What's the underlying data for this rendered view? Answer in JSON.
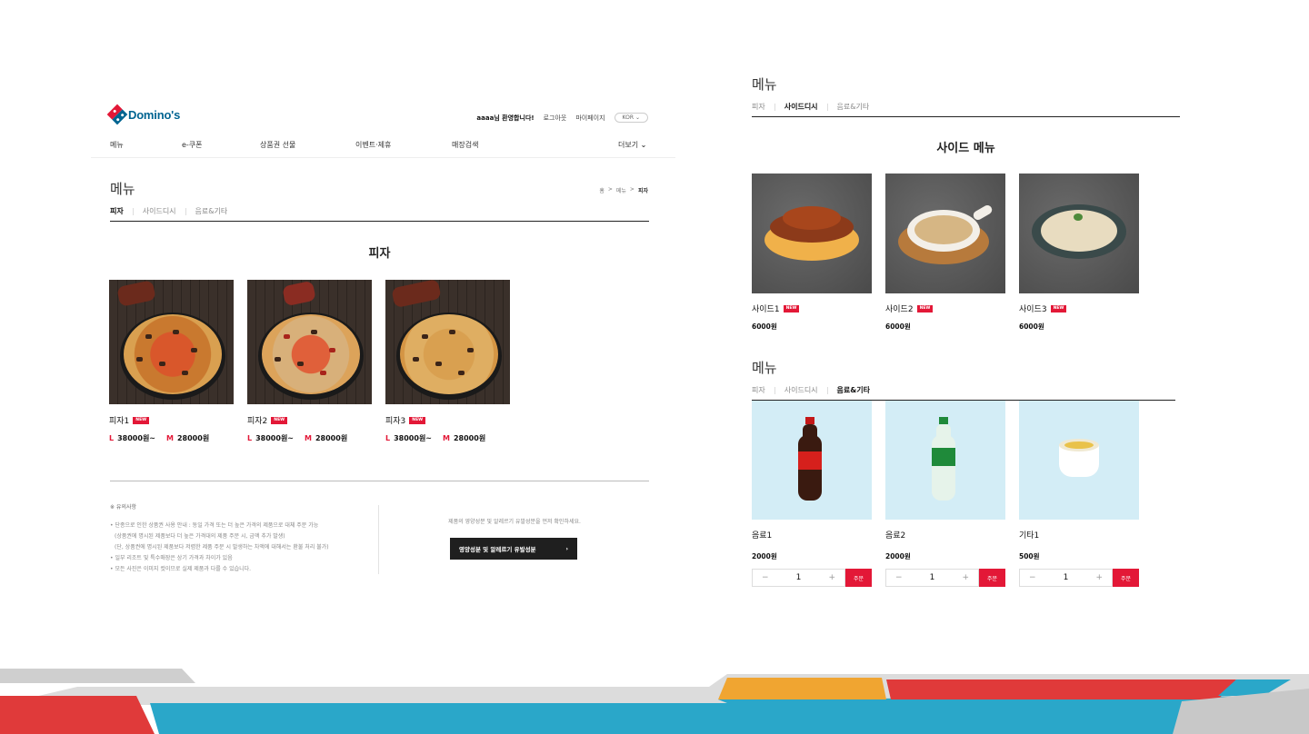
{
  "left": {
    "brand": "Domino's",
    "util": {
      "welcome": "aaaa님 환영합니다!",
      "logout": "로그아웃",
      "mypage": "마이페이지",
      "lang": "KOR"
    },
    "gnb": [
      "메뉴",
      "e-쿠폰",
      "상품권 선물",
      "이벤트·제휴",
      "매장검색",
      "더보기"
    ],
    "title": "메뉴",
    "breadcrumb": [
      "홈",
      ">",
      "메뉴",
      ">",
      "피자"
    ],
    "tabs": [
      "피자",
      "사이드디시",
      "음료&기타"
    ],
    "section": "피자",
    "new_label": "NEW",
    "pizzas": [
      {
        "name": "피자1",
        "l_label": "L",
        "l_price": "38000원~",
        "m_label": "M",
        "m_price": "28000원"
      },
      {
        "name": "피자2",
        "l_label": "L",
        "l_price": "38000원~",
        "m_label": "M",
        "m_price": "28000원"
      },
      {
        "name": "피자3",
        "l_label": "L",
        "l_price": "38000원~",
        "m_label": "M",
        "m_price": "28000원"
      }
    ],
    "notice": {
      "title": "※ 유의사항",
      "items": [
        "• 단종으로 인한 상품권 사용 안내 : 동일 가격 또는 더 높은 가격의 제품으로 대체 주문 가능",
        "  (상품권에 명시된 제품보다 더 높은 가격대의 제품 주문 시, 금액 추가 발생)",
        "  (단, 상품권에 명시된 제품보다 저렴한 제품 주문 시 발생하는 차액에 대해서는 환불 처리 불가)",
        "• 일부 리조트 및 특수매장은 상기 가격과 차이가 있음",
        "• 모든 사진은 이미지 컷이므로 실제 제품과 다를 수 있습니다."
      ]
    },
    "nutrition": {
      "text": "제품의 영양성분 및 알레르기 유발성분을 먼저 확인하세요.",
      "button": "영양성분 및 알레르기 유발성분"
    }
  },
  "right": {
    "side_title": "메뉴",
    "side_tabs": [
      "피자",
      "사이드디시",
      "음료&기타"
    ],
    "side_section": "사이드 메뉴",
    "new_label": "NEW",
    "sides": [
      {
        "name": "사이드1",
        "price": "6000원"
      },
      {
        "name": "사이드2",
        "price": "6000원"
      },
      {
        "name": "사이드3",
        "price": "6000원"
      }
    ],
    "drink_title": "메뉴",
    "drink_tabs": [
      "피자",
      "사이드디시",
      "음료&기타"
    ],
    "drinks": [
      {
        "name": "음료1",
        "price": "2000원",
        "qty": "1",
        "minus": "−",
        "plus": "+",
        "order": "주문"
      },
      {
        "name": "음료2",
        "price": "2000원",
        "qty": "1",
        "minus": "−",
        "plus": "+",
        "order": "주문"
      },
      {
        "name": "기타1",
        "price": "500원",
        "qty": "1",
        "minus": "−",
        "plus": "+",
        "order": "주문"
      }
    ]
  },
  "colors": {
    "brand_red": "#e31837",
    "brand_blue": "#006491",
    "decor_red": "#e03a3a",
    "decor_teal": "#2aa7c9",
    "decor_orange": "#f0a531",
    "decor_gray": "#d0d0d0"
  }
}
